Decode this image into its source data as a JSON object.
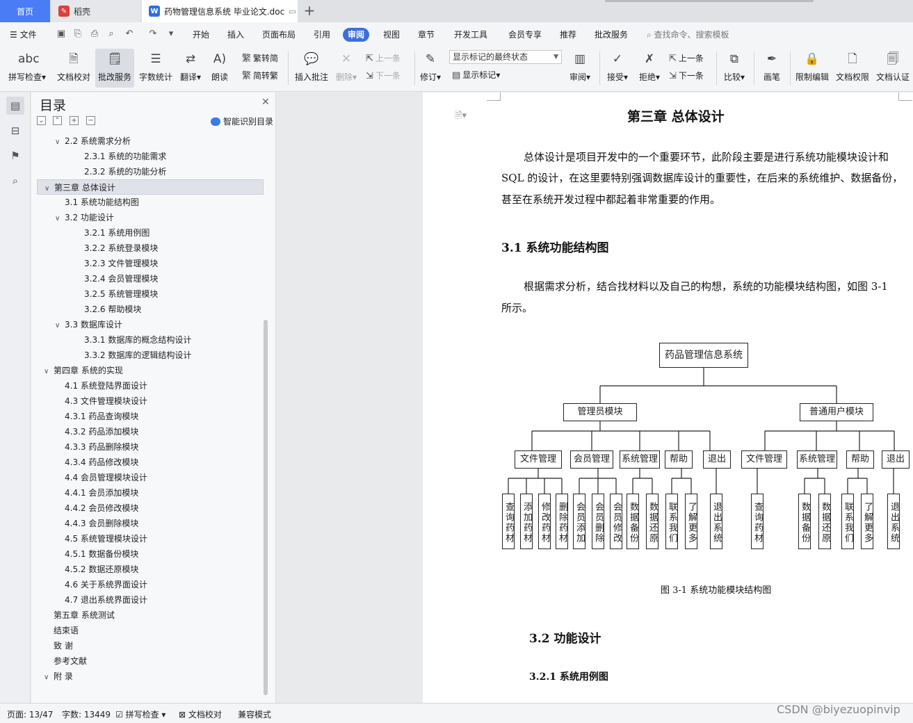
{
  "tabs": {
    "home": "首页",
    "daoke": "稻壳",
    "doc": "药物管理信息系统 毕业论文.doc"
  },
  "menu": {
    "file": "文件",
    "items": [
      "开始",
      "插入",
      "页面布局",
      "引用",
      "审阅",
      "视图",
      "章节",
      "开发工具",
      "会员专享",
      "推荐",
      "批改服务"
    ],
    "search": "查找命令、搜索模板"
  },
  "ribbon": {
    "spell": "拼写检查",
    "doccheck": "文档校对",
    "correct": "批改服务",
    "wordcount": "字数统计",
    "translate": "翻译",
    "read": "朗读",
    "to_trad": "繁转简",
    "to_simp": "简转繁",
    "insert_comment": "插入批注",
    "delete": "删除",
    "prev": "上一条",
    "next": "下一条",
    "revise": "修订",
    "markup_state": "显示标记的最终状态",
    "show_markup": "显示标记",
    "review": "审阅",
    "accept": "接受",
    "reject": "拒绝",
    "prev2": "上一条",
    "next2": "下一条",
    "compare": "比较",
    "pen": "画笔",
    "restrict": "限制编辑",
    "rights": "文档权限",
    "certify": "文档认证"
  },
  "toc": {
    "title": "目录",
    "smart": "智能识别目录",
    "items": [
      {
        "label": "2.2  系统需求分析",
        "level": 2,
        "caret": "v"
      },
      {
        "label": "2.3.1  系统的功能需求",
        "level": 3,
        "caret": ""
      },
      {
        "label": "2.3.2  系统的功能分析",
        "level": 3,
        "caret": ""
      },
      {
        "label": "第三章  总体设计",
        "level": 1,
        "caret": "v",
        "sel": true
      },
      {
        "label": "3.1  系统功能结构图",
        "level": 2,
        "caret": ""
      },
      {
        "label": "3.2  功能设计",
        "level": 2,
        "caret": "v"
      },
      {
        "label": "3.2.1  系统用例图",
        "level": 3,
        "caret": ""
      },
      {
        "label": "3.2.2  系统登录模块",
        "level": 3,
        "caret": ""
      },
      {
        "label": "3.2.3  文件管理模块",
        "level": 3,
        "caret": ""
      },
      {
        "label": "3.2.4  会员管理模块",
        "level": 3,
        "caret": ""
      },
      {
        "label": "3.2.5  系统管理模块",
        "level": 3,
        "caret": ""
      },
      {
        "label": "3.2.6  帮助模块",
        "level": 3,
        "caret": ""
      },
      {
        "label": "3.3  数据库设计",
        "level": 2,
        "caret": "v"
      },
      {
        "label": "3.3.1  数据库的概念结构设计",
        "level": 3,
        "caret": ""
      },
      {
        "label": "3.3.2  数据库的逻辑结构设计",
        "level": 3,
        "caret": ""
      },
      {
        "label": "第四章  系统的实现",
        "level": 1,
        "caret": "v"
      },
      {
        "label": "4.1  系统登陆界面设计",
        "level": 2,
        "caret": ""
      },
      {
        "label": "4.3  文件管理模块设计",
        "level": 2,
        "caret": ""
      },
      {
        "label": "4.3.1 药品查询模块",
        "level": 2,
        "caret": ""
      },
      {
        "label": "4.3.2  药品添加模块",
        "level": 2,
        "caret": ""
      },
      {
        "label": "4.3.3 药品删除模块",
        "level": 2,
        "caret": ""
      },
      {
        "label": "4.3.4 药品修改模块",
        "level": 2,
        "caret": ""
      },
      {
        "label": "4.4 会员管理模块设计",
        "level": 2,
        "caret": ""
      },
      {
        "label": "4.4.1 会员添加模块",
        "level": 2,
        "caret": ""
      },
      {
        "label": "4.4.2 会员修改模块",
        "level": 2,
        "caret": ""
      },
      {
        "label": "4.4.3 会员删除模块",
        "level": 2,
        "caret": ""
      },
      {
        "label": "4.5  系统管理模块设计",
        "level": 2,
        "caret": ""
      },
      {
        "label": "4.5.1  数据备份模块",
        "level": 2,
        "caret": ""
      },
      {
        "label": "4.5.2  数据还原模块",
        "level": 2,
        "caret": ""
      },
      {
        "label": "4.6  关于系统界面设计",
        "level": 2,
        "caret": ""
      },
      {
        "label": "4.7  退出系统界面设计",
        "level": 2,
        "caret": ""
      },
      {
        "label": "第五章  系统测试",
        "level": 1,
        "caret": ""
      },
      {
        "label": "结束语",
        "level": 1,
        "caret": ""
      },
      {
        "label": "致   谢",
        "level": 1,
        "caret": ""
      },
      {
        "label": "参考文献",
        "level": 1,
        "caret": ""
      },
      {
        "label": "附   录",
        "level": 1,
        "caret": "v"
      }
    ]
  },
  "doc": {
    "chapter_title": "第三章  总体设计",
    "p1_line1": "总体设计是项目开发中的一个重要环节，此阶段主要是进行系统功能模块设计和",
    "p1_line2": "SQL 的设计，在这里要特别强调数据库设计的重要性，在后来的系统维护、数据备份，",
    "p1_line3": "甚至在系统开发过程中都起着非常重要的作用。",
    "h31": "3.1  系统功能结构图",
    "p2_line1": "根据需求分析，结合找材料以及自己的构想，系统的功能模块结构图，如图 3-1",
    "p2_line2": "所示。",
    "fig_caption": "图 3-1 系统功能模块结构图",
    "h32": "3.2  功能设计",
    "h321": "3.2.1 系统用例图"
  },
  "diagram": {
    "root": "药品管理信息系统",
    "admin": "管理员模块",
    "user": "普通用户模块",
    "admin_mods": [
      "文件管理",
      "会员管理",
      "系统管理",
      "帮助",
      "退出"
    ],
    "user_mods": [
      "文件管理",
      "系统管理",
      "帮助",
      "退出"
    ],
    "admin_leaves": [
      "查询药材",
      "添加药材",
      "修改药材",
      "删除药材",
      "会员添加",
      "会员删除",
      "会员修改",
      "数据备份",
      "数据还原",
      "联系我们",
      "了解更多",
      "退出系统"
    ],
    "user_leaves": [
      "查询药材",
      "数据备份",
      "数据还原",
      "联系我们",
      "了解更多",
      "退出系统"
    ]
  },
  "status": {
    "page": "页面: 13/47",
    "words": "字数: 13449",
    "spell": "拼写检查",
    "doccheck": "文档校对",
    "compat": "兼容模式"
  },
  "watermark": "CSDN @biyezuopinvip",
  "colors": {
    "accent": "#3b6fe0",
    "home_tab": "#4a7cf6"
  }
}
